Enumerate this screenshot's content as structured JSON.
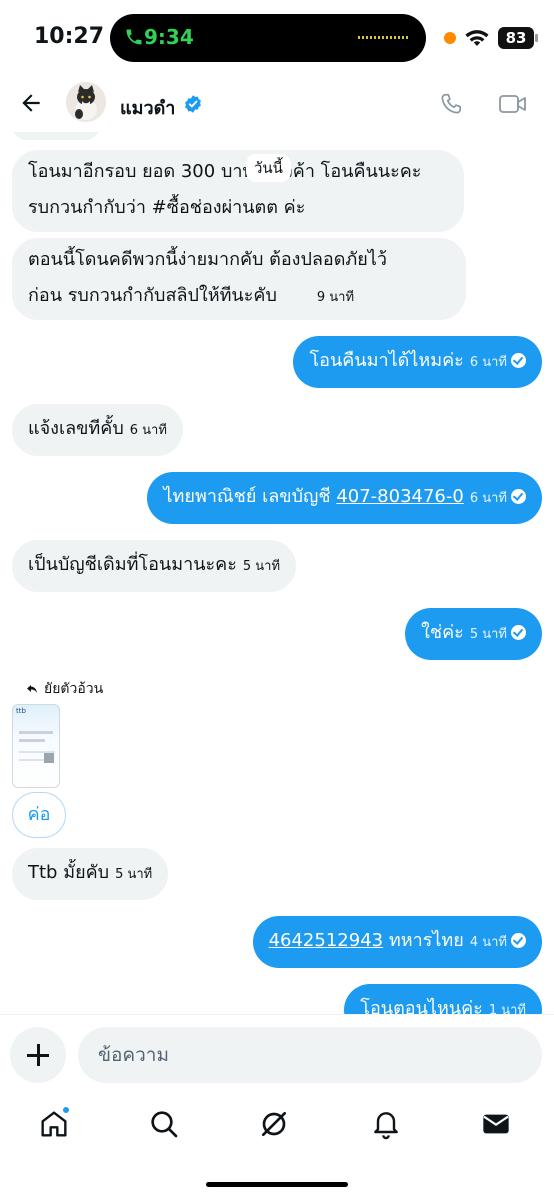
{
  "status_bar": {
    "time": "10:27",
    "call_time": "9:34",
    "battery": "83"
  },
  "header": {
    "contact_name": "แมวดำ"
  },
  "chat": {
    "date_divider": "วันนี้",
    "messages": [
      {
        "dir": "in",
        "text": "โอนมาอีกรอบ ยอด 300 บาท แล้วค้า โอนคืนนะคะ รบกวนกำกับว่า #ซื้อช่องผ่านตต ค่ะ",
        "line1": "โอนมาอีกรอบ ยอด 300 บาท แล้วค้า โอนคืนนะคะ",
        "line2": "รบกวนกำกับว่า #ซื้อช่องผ่านตต ค่ะ",
        "time": ""
      },
      {
        "dir": "in",
        "line1": "ตอนนี้โดนคดีพวกนี้ง่ายมากคับ ต้องปลอดภัยไว้",
        "line2": "ก่อน รบกวนกำกับสลิปให้ทีนะคับ",
        "time": "9 นาที"
      },
      {
        "dir": "out",
        "text": "โอนคืนมาได้ไหมค่ะ",
        "time": "6 นาที"
      },
      {
        "dir": "in",
        "text": "แจ้งเลขทีคั้บ",
        "time": "6 นาที"
      },
      {
        "dir": "out",
        "prefix": "ไทยพาณิชย์ เลขบัญชี",
        "link": "407-803476-0",
        "time": "6 นาที"
      },
      {
        "dir": "in",
        "text": "เป็นบัญชีเดิมที่โอนมานะคะ",
        "time": "5 นาที"
      },
      {
        "dir": "out",
        "text": "ใช่ค่ะ",
        "time": "5 นาที"
      },
      {
        "dir": "in",
        "text": "Ttb มั้ยคับ",
        "time": "5 นาที"
      },
      {
        "dir": "out",
        "link": "4642512943",
        "suffix": "ทหารไทย",
        "time": "4 นาที"
      },
      {
        "dir": "out",
        "text": "โอนตอนไหนค่ะ",
        "time": "1 นาที"
      }
    ],
    "reply_label": "ยัยตัวอ้วน",
    "slip_brand": "ttb",
    "reaction_text": "ค่อ"
  },
  "composer": {
    "placeholder": "ข้อความ"
  },
  "icons": {
    "back": "back-arrow-icon",
    "verified": "verified-badge-icon",
    "call": "phone-icon",
    "video": "video-camera-icon",
    "home": "home-icon",
    "search": "search-icon",
    "grok": "grok-icon",
    "notifications": "bell-icon",
    "messages": "envelope-icon"
  },
  "colors": {
    "accent": "#1d9bf0",
    "incoming_bubble": "#eff3f4",
    "call_green": "#31d158"
  }
}
